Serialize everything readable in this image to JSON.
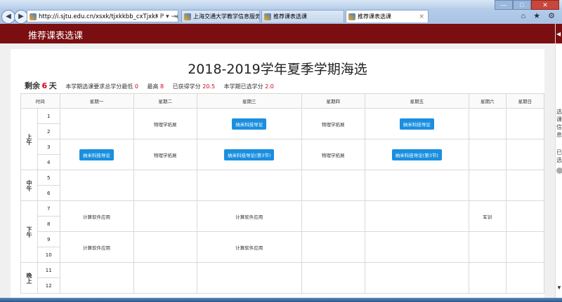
{
  "browser": {
    "address": "http://i.sjtu.edu.cn/xsxk/tjxkkbb_cxTjxkKbbIndex.h",
    "address_tools": "P ▾ →",
    "tabs": [
      {
        "label": "上海交通大学教学信息服务网",
        "active": false
      },
      {
        "label": "推荐课表选课",
        "active": false
      },
      {
        "label": "推荐课表选课",
        "active": true
      }
    ],
    "tab_close": "×",
    "window_buttons": [
      "—",
      "□",
      "✕"
    ],
    "right_tools": "⌂ ★ ⚙"
  },
  "app": {
    "header_title": "推荐课表选课"
  },
  "page": {
    "title": "2018-2019学年夏季学期海选",
    "summary": {
      "remaining_label": "剩余",
      "remaining_value": "6",
      "remaining_unit": "天",
      "requirement_label": "本学期选课要求总学分最低",
      "min_credits": "0",
      "max_label": "最高",
      "max_credits": "8",
      "earned_label": "已获得学分",
      "earned_credits": "20.5",
      "selected_label": "本学期已选学分",
      "selected_credits": "2.0"
    },
    "table": {
      "corner": "时间",
      "days": [
        "星期一",
        "星期二",
        "星期三",
        "星期四",
        "星期五",
        "星期六",
        "星期日"
      ],
      "periods": {
        "morning": "上午",
        "noon": "中午",
        "afternoon": "下午",
        "evening": "晚上"
      },
      "slots": [
        "1",
        "2",
        "3",
        "4",
        "5",
        "6",
        "7",
        "8",
        "9",
        "10",
        "11",
        "12"
      ],
      "cells": {
        "tue_12": "物理学拓展",
        "wed_12": "纳米科技导论",
        "thu_12": "物理学拓展",
        "fri_12": "纳米科技导论",
        "mon_34": "纳米科技导论",
        "tue_34": "物理学拓展",
        "wed_34": "纳米科技导论(第3节)",
        "thu_34": "物理学拓展",
        "fri_34": "纳米科技导论(第3节)",
        "mon_78": "计算软件应用",
        "wed_78": "计算软件应用",
        "sat_78": "军训",
        "mon_910": "计算软件应用",
        "wed_910": "计算软件应用"
      }
    }
  },
  "sidebar_right": {
    "label1": "选课信息",
    "label2": "已选"
  },
  "colors": {
    "header": "#7a0e11",
    "accent_red": "#d0021b",
    "badge_blue": "#1a8fe0"
  }
}
